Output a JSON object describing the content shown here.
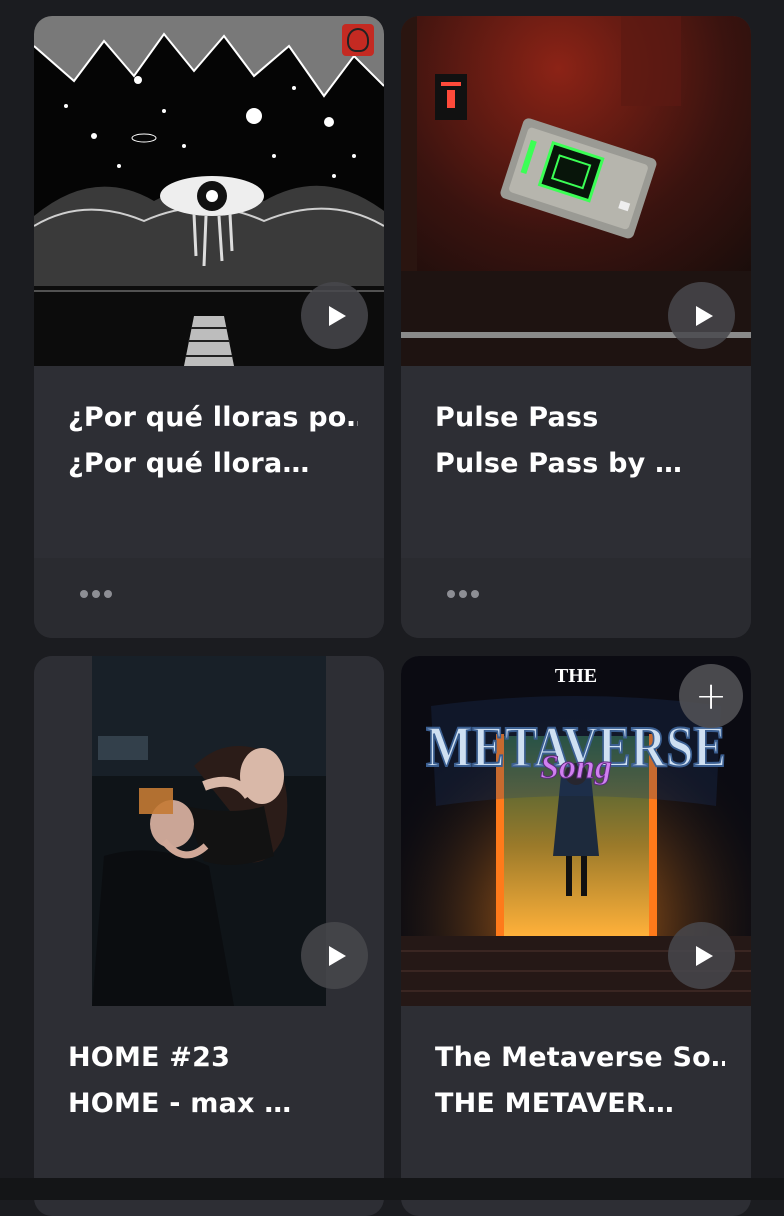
{
  "cards": [
    {
      "title": "¿Por qué lloras po…",
      "subtitle": "¿Por qué llora…",
      "artwork": "black-and-white night sky with eye and pier",
      "has_play": true,
      "has_more": true,
      "badge_icon": "shield-crest-icon"
    },
    {
      "title": "Pulse Pass",
      "subtitle": "Pulse Pass by …",
      "artwork": "glowing green card on dark red wall",
      "has_play": true,
      "has_more": true
    },
    {
      "title": "HOME #23",
      "subtitle": "HOME - max …",
      "artwork": "woman feeding man in dark scene",
      "has_play": true
    },
    {
      "title": "The Metaverse So…",
      "subtitle": "THE METAVER…",
      "artwork": "The Metaverse Song cover with door",
      "artwork_text": {
        "top": "THE",
        "main": "METAVERSE",
        "script": "Song"
      },
      "has_play": true,
      "has_add": true
    }
  ],
  "icons": {
    "play": "play-icon",
    "more": "more-dots-icon",
    "add": "plus-icon"
  },
  "colors": {
    "background": "#1b1c20",
    "card": "#2d2e34",
    "text": "#ffffff"
  }
}
